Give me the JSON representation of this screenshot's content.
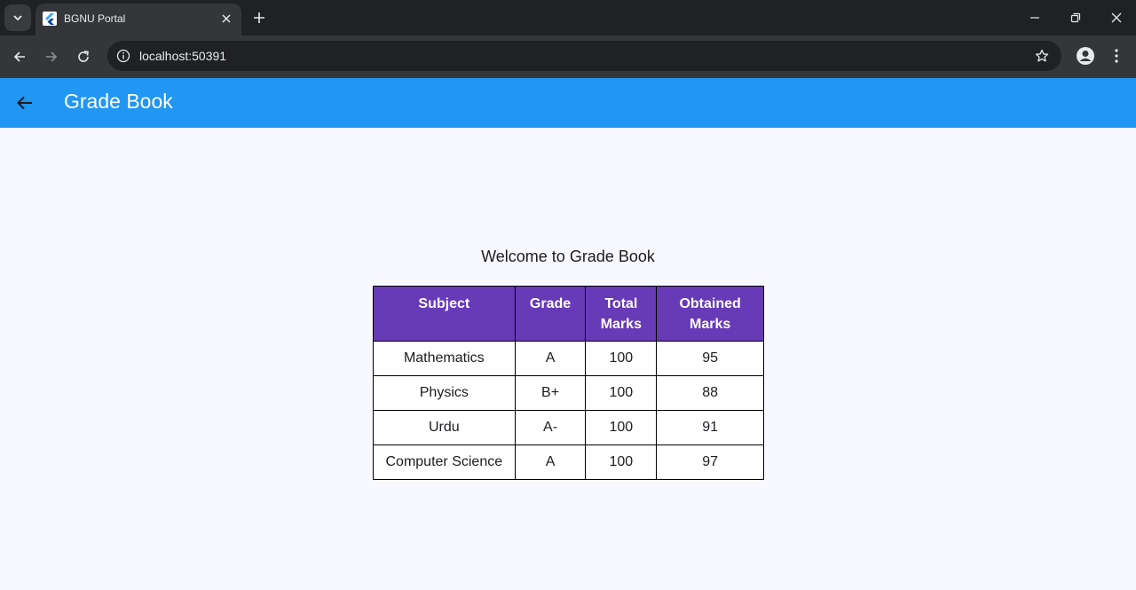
{
  "browser": {
    "tab_title": "BGNU Portal",
    "url": "localhost:50391"
  },
  "appbar": {
    "title": "Grade Book"
  },
  "main": {
    "welcome": "Welcome to Grade Book",
    "table": {
      "headers": [
        [
          "Subject"
        ],
        [
          "Grade"
        ],
        [
          "Total",
          "Marks"
        ],
        [
          "Obtained",
          "Marks"
        ]
      ],
      "rows": [
        [
          "Mathematics",
          "A",
          "100",
          "95"
        ],
        [
          "Physics",
          "B+",
          "100",
          "88"
        ],
        [
          "Urdu",
          "A-",
          "100",
          "91"
        ],
        [
          "Computer Science",
          "A",
          "100",
          "97"
        ]
      ]
    }
  },
  "colors": {
    "appbar": "#2196f3",
    "table_header": "#673ab7",
    "background": "#f8f9fe"
  }
}
